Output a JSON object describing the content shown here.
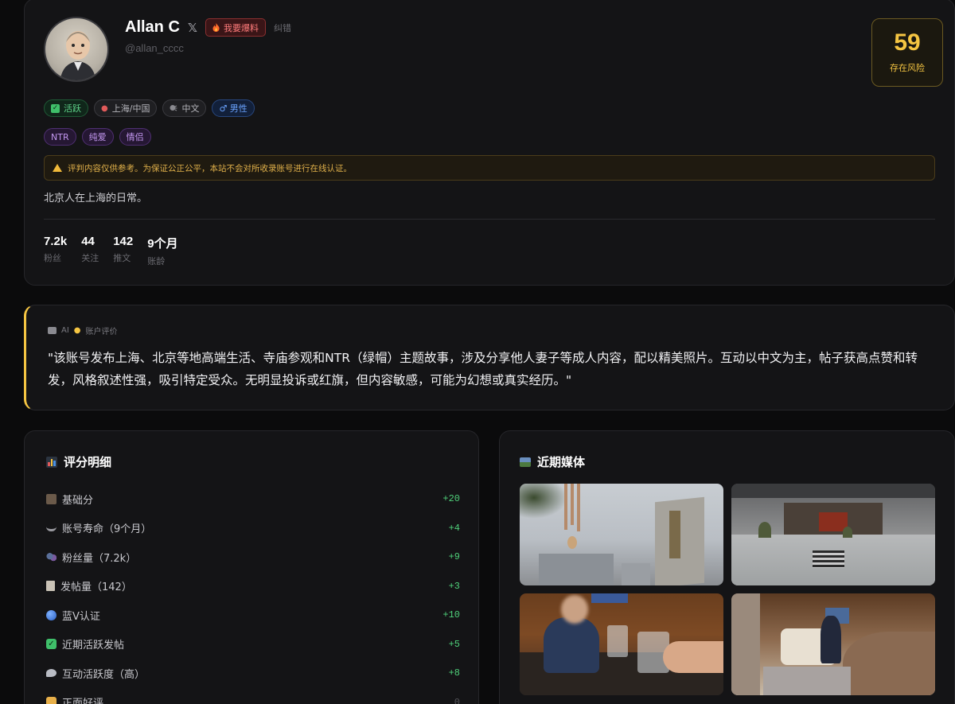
{
  "profile": {
    "name": "Allan C",
    "x_icon": "𝕏",
    "expose_label": "我要爆料",
    "correct_label": "纠错",
    "handle": "@allan_cccc",
    "risk_score": "59",
    "risk_label": "存在风险",
    "tags": [
      "活跃",
      "上海/中国",
      "中文",
      "♂ 男性"
    ],
    "topic_tags": [
      "NTR",
      "纯爱",
      "情侣"
    ],
    "warning": "评判内容仅供参考。为保证公正公平，本站不会对所收录账号进行在线认证。",
    "bio": "北京人在上海的日常。",
    "stats": [
      {
        "value": "7.2k",
        "label": "粉丝"
      },
      {
        "value": "44",
        "label": "关注"
      },
      {
        "value": "142",
        "label": "推文"
      },
      {
        "value": "9个月",
        "label": "账龄"
      }
    ]
  },
  "ai": {
    "badge": "AI",
    "heading": "账户评价",
    "text": "\"该账号发布上海、北京等地高端生活、寺庙参观和NTR（绿帽）主题故事，涉及分享他人妻子等成人内容，配以精美照片。互动以中文为主，帖子获高点赞和转发，风格叙述性强，吸引特定受众。无明显投诉或红旗，但内容敏感，可能为幻想或真实经历。\""
  },
  "score": {
    "title": "评分明细",
    "rows": [
      {
        "label": "基础分",
        "value": "+20",
        "icon": "notebook-icon"
      },
      {
        "label": "账号寿命（9个月）",
        "value": "+4",
        "icon": "hourglass-icon"
      },
      {
        "label": "粉丝量（7.2k）",
        "value": "+9",
        "icon": "people-icon"
      },
      {
        "label": "发帖量（142）",
        "value": "+3",
        "icon": "document-icon"
      },
      {
        "label": "蓝V认证",
        "value": "+10",
        "icon": "blue-circle-icon"
      },
      {
        "label": "近期活跃发帖",
        "value": "+5",
        "icon": "checkbox-icon"
      },
      {
        "label": "互动活跃度（高）",
        "value": "+8",
        "icon": "speech-bubble-icon"
      },
      {
        "label": "正面好评",
        "value": "0",
        "icon": "thumbs-up-icon"
      }
    ]
  },
  "media": {
    "title": "近期媒体"
  }
}
